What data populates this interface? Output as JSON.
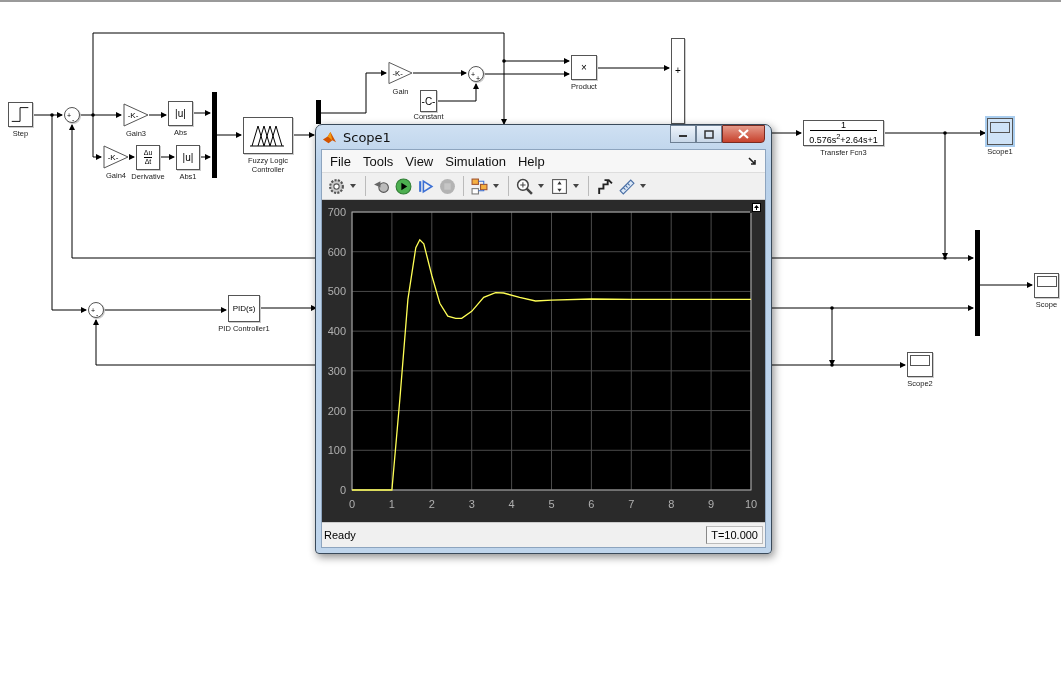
{
  "diagram": {
    "blocks": [
      {
        "kind": "step",
        "label": "Step",
        "selected": false
      },
      {
        "kind": "sum",
        "signs": [
          "+",
          "-"
        ],
        "selected": false
      },
      {
        "kind": "gain",
        "content": "-K-",
        "label": "Gain3",
        "selected": false
      },
      {
        "kind": "abs",
        "content": "|u|",
        "label": "Abs",
        "selected": false
      },
      {
        "kind": "gain",
        "content": "-K-",
        "label": "Gain4",
        "selected": false
      },
      {
        "kind": "derivative",
        "numerator": "Δu",
        "denominator": "Δt",
        "label": "Derivative",
        "selected": false
      },
      {
        "kind": "abs",
        "content": "|u|",
        "label": "Abs1",
        "selected": false
      },
      {
        "kind": "mux",
        "selected": false
      },
      {
        "kind": "fuzzy",
        "label": "Fuzzy Logic Controller",
        "selected": false
      },
      {
        "kind": "mux",
        "selected": false
      },
      {
        "kind": "gain",
        "content": "-K-",
        "label": "Gain",
        "selected": false
      },
      {
        "kind": "sum",
        "signs": [
          "+",
          "+"
        ],
        "selected": false
      },
      {
        "kind": "constant",
        "content": "-C-",
        "label": "Constant",
        "selected": false
      },
      {
        "kind": "product",
        "content": "×",
        "label": "Product",
        "selected": false
      },
      {
        "kind": "bus",
        "content": "+",
        "selected": false
      },
      {
        "kind": "transfer_fcn",
        "numerator": "1",
        "denominator": "0.576s$^{2}$+2.64s+1",
        "label": "Transfer Fcn3",
        "selected": false
      },
      {
        "kind": "scope",
        "label": "Scope1",
        "selected": true
      },
      {
        "kind": "mux",
        "selected": false
      },
      {
        "kind": "scope",
        "label": "Scope",
        "selected": false
      },
      {
        "kind": "sum",
        "signs": [
          "+",
          "-"
        ],
        "selected": false
      },
      {
        "kind": "pid",
        "content": "PID(s)",
        "label": "PID Controller1",
        "selected": false
      },
      {
        "kind": "scope",
        "label": "Scope2",
        "selected": false
      }
    ]
  },
  "scope_window": {
    "title": "Scope1",
    "menu": [
      "File",
      "Tools",
      "View",
      "Simulation",
      "Help"
    ],
    "toolbar": [
      {
        "kind": "settings",
        "has_menu": true,
        "disabled": false,
        "separator_after": true
      },
      {
        "kind": "step_back",
        "has_menu": false,
        "disabled": false,
        "separator_after": false
      },
      {
        "kind": "run",
        "has_menu": false,
        "disabled": false,
        "separator_after": false
      },
      {
        "kind": "step_forward",
        "has_menu": false,
        "disabled": false,
        "separator_after": false
      },
      {
        "kind": "stop",
        "has_menu": false,
        "disabled": true,
        "separator_after": true
      },
      {
        "kind": "signal_select",
        "has_menu": true,
        "disabled": false,
        "separator_after": true
      },
      {
        "kind": "zoom",
        "has_menu": true,
        "disabled": false,
        "separator_after": false
      },
      {
        "kind": "scale_axes",
        "has_menu": true,
        "disabled": false,
        "separator_after": true
      },
      {
        "kind": "highlight",
        "has_menu": false,
        "disabled": false,
        "separator_after": false
      },
      {
        "kind": "measure",
        "has_menu": true,
        "disabled": false,
        "separator_after": false
      }
    ],
    "chart_data": {
      "type": "line",
      "x": [
        0,
        1,
        1.2,
        1.4,
        1.6,
        1.7,
        1.8,
        2.0,
        2.2,
        2.4,
        2.6,
        2.75,
        3.0,
        3.3,
        3.6,
        3.8,
        4.2,
        4.6,
        5.0,
        6.0,
        7,
        8,
        9,
        10
      ],
      "series": [
        {
          "color": "#ffff55",
          "values": [
            0,
            0,
            230,
            480,
            610,
            630,
            620,
            540,
            470,
            438,
            432,
            432,
            450,
            485,
            497,
            496,
            485,
            476,
            478,
            481,
            480,
            480,
            480,
            480
          ]
        }
      ],
      "xlim": [
        0,
        10
      ],
      "ylim": [
        0,
        700
      ],
      "xticks": [
        0,
        1,
        2,
        3,
        4,
        5,
        6,
        7,
        8,
        9,
        10
      ],
      "yticks": [
        0,
        100,
        200,
        300,
        400,
        500,
        600,
        700
      ],
      "grid": true
    },
    "status": {
      "text": "Ready",
      "time": "T=10.000"
    }
  }
}
